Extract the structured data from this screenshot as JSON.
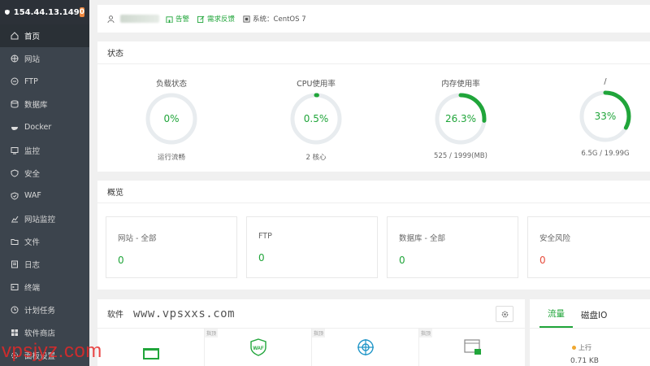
{
  "sidebar": {
    "ip": "154.44.13.149",
    "badge": "0",
    "items": [
      {
        "label": "首页",
        "icon": "home-icon",
        "active": true
      },
      {
        "label": "网站",
        "icon": "globe-icon"
      },
      {
        "label": "FTP",
        "icon": "ftp-icon"
      },
      {
        "label": "数据库",
        "icon": "database-icon"
      },
      {
        "label": "Docker",
        "icon": "docker-icon"
      },
      {
        "label": "监控",
        "icon": "monitor-icon"
      },
      {
        "label": "安全",
        "icon": "shield-icon"
      },
      {
        "label": "WAF",
        "icon": "waf-icon"
      },
      {
        "label": "网站监控",
        "icon": "chart-icon"
      },
      {
        "label": "文件",
        "icon": "folder-icon"
      },
      {
        "label": "日志",
        "icon": "log-icon"
      },
      {
        "label": "终端",
        "icon": "terminal-icon"
      },
      {
        "label": "计划任务",
        "icon": "clock-icon"
      },
      {
        "label": "软件商店",
        "icon": "store-icon"
      },
      {
        "label": "面板设置",
        "icon": "settings-icon"
      }
    ]
  },
  "topbar": {
    "notice": "告警",
    "feedback": "需求反馈",
    "system": "系统：CentOS 7"
  },
  "status": {
    "title": "状态",
    "gauges": [
      {
        "label": "负载状态",
        "value": "0%",
        "percent": 0,
        "sub": "运行流畅"
      },
      {
        "label": "CPU使用率",
        "value": "0.5%",
        "percent": 0.5,
        "sub": "2 核心"
      },
      {
        "label": "内存使用率",
        "value": "26.3%",
        "percent": 26.3,
        "sub": "525 / 1999(MB)"
      },
      {
        "label": "/",
        "value": "33%",
        "percent": 33,
        "sub": "6.5G / 19.99G"
      }
    ]
  },
  "overview": {
    "title": "概览",
    "cards": [
      {
        "label": "网站 - 全部",
        "value": "0",
        "color": "green"
      },
      {
        "label": "FTP",
        "value": "0",
        "color": "green"
      },
      {
        "label": "数据库 - 全部",
        "value": "0",
        "color": "green"
      },
      {
        "label": "安全风险",
        "value": "0",
        "color": "red"
      }
    ]
  },
  "software": {
    "title": "软件",
    "watermark": "www.vpsxxs.com",
    "pin_label": "指顶",
    "items": [
      "app-icon",
      "waf-icon",
      "network-icon",
      "security-browser-icon"
    ]
  },
  "traffic": {
    "tabs": [
      "流量",
      "磁盘IO"
    ],
    "up_label": "上行",
    "up_value": "0.71 KB"
  },
  "site_watermark": "vpsjyz.com",
  "colors": {
    "accent": "#20a53a",
    "sidebar": "#3c444d",
    "danger": "#e74c3c",
    "ring_track": "#e8ecef"
  }
}
